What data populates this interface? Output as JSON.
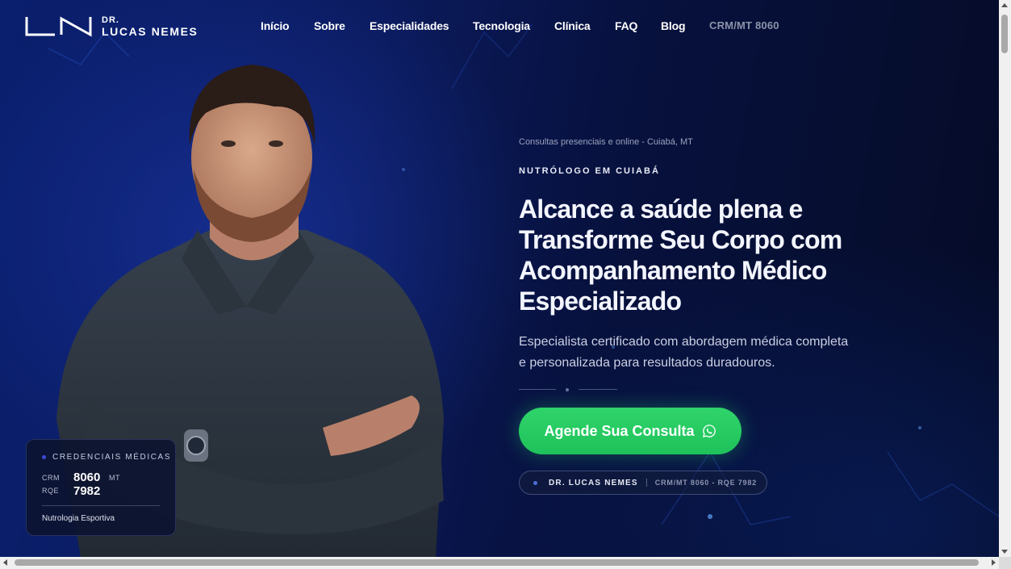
{
  "logo": {
    "prefix": "DR.",
    "name": "LUCAS NEMES"
  },
  "nav": {
    "items": [
      {
        "label": "Início"
      },
      {
        "label": "Sobre"
      },
      {
        "label": "Especialidades"
      },
      {
        "label": "Tecnologia"
      },
      {
        "label": "Clínica"
      },
      {
        "label": "FAQ"
      },
      {
        "label": "Blog"
      }
    ],
    "crm": "CRM/MT 8060"
  },
  "hero": {
    "location_note": "Consultas presenciais e online - Cuiabá, MT",
    "eyebrow": "NUTRÓLOGO EM CUIABÁ",
    "headline": "Alcance a saúde plena e Transforme Seu Corpo com Acompanhamento Médico Especializado",
    "lead": "Especialista certificado com abordagem médica completa e personalizada para resultados duradouros.",
    "cta_label": "Agende Sua Consulta",
    "cta_icon": "whatsapp-icon",
    "badge": {
      "name": "DR. LUCAS NEMES",
      "credentials": "CRM/MT 8060 - RQE 7982"
    }
  },
  "credentials_card": {
    "title": "CREDENCIAIS MÉDICAS",
    "crm_label": "CRM",
    "crm_number": "8060",
    "crm_state": "MT",
    "rqe_label": "RQE",
    "rqe_number": "7982",
    "specialty": "Nutrologia Esportiva"
  },
  "colors": {
    "background": "#0a1f6e",
    "cta": "#22c55e",
    "accent_dot": "#3b49d9"
  }
}
